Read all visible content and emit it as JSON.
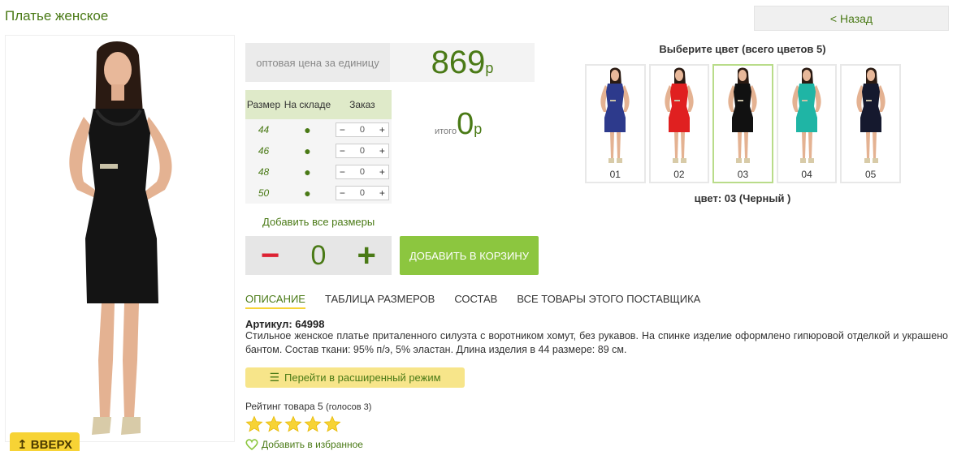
{
  "page": {
    "title": "Платье женское",
    "back_label": "< Назад",
    "up_label": "↥ ВВЕРХ"
  },
  "price": {
    "label": "оптовая цена за единицу",
    "value": "869",
    "currency": "р"
  },
  "sizes": {
    "headers": [
      "Размер",
      "На складе",
      "Заказ"
    ],
    "rows": [
      {
        "size": "44",
        "stock": "●",
        "qty": "0"
      },
      {
        "size": "46",
        "stock": "●",
        "qty": "0"
      },
      {
        "size": "48",
        "stock": "●",
        "qty": "0"
      },
      {
        "size": "50",
        "stock": "●",
        "qty": "0"
      }
    ],
    "minus": "−",
    "plus": "+"
  },
  "total": {
    "label": "итого",
    "value": "0",
    "currency": "р"
  },
  "add_all_sizes": "Добавить все размеры",
  "quantity": {
    "minus": "−",
    "value": "0",
    "plus": "+"
  },
  "cart_button": "ДОБАВИТЬ В КОРЗИНУ",
  "colors": {
    "title": "Выберите цвет (всего цветов 5)",
    "items": [
      {
        "no": "01",
        "color": "#2d3a8c"
      },
      {
        "no": "02",
        "color": "#e02020"
      },
      {
        "no": "03",
        "color": "#111111"
      },
      {
        "no": "04",
        "color": "#1fb5a5"
      },
      {
        "no": "05",
        "color": "#15192e"
      }
    ],
    "selected_index": 2,
    "selected_label": "цвет: 03 (Черный )"
  },
  "tabs": [
    "ОПИСАНИЕ",
    "ТАБЛИЦА РАЗМЕРОВ",
    "СОСТАВ",
    "ВСЕ ТОВАРЫ ЭТОГО ПОСТАВЩИКА"
  ],
  "article": "Артикул: 64998",
  "description": "Стильное женское платье приталенного силуэта с воротником хомут, без рукавов. На спинке изделие оформлено гипюровой отделкой и украшено бантом. Состав ткани: 95% п/э, 5% эластан. Длина изделия в 44 размере: 89 см.",
  "extended_mode": "Перейти в расширенный режим",
  "rating": {
    "label": "Рейтинг товара 5",
    "votes": "(голосов 3)",
    "stars": 5
  },
  "favorite": "Добавить в избранное",
  "colors_theme": {
    "accent_green": "#4a7a16",
    "button_green": "#8cc63f",
    "yellow": "#f7d335"
  }
}
